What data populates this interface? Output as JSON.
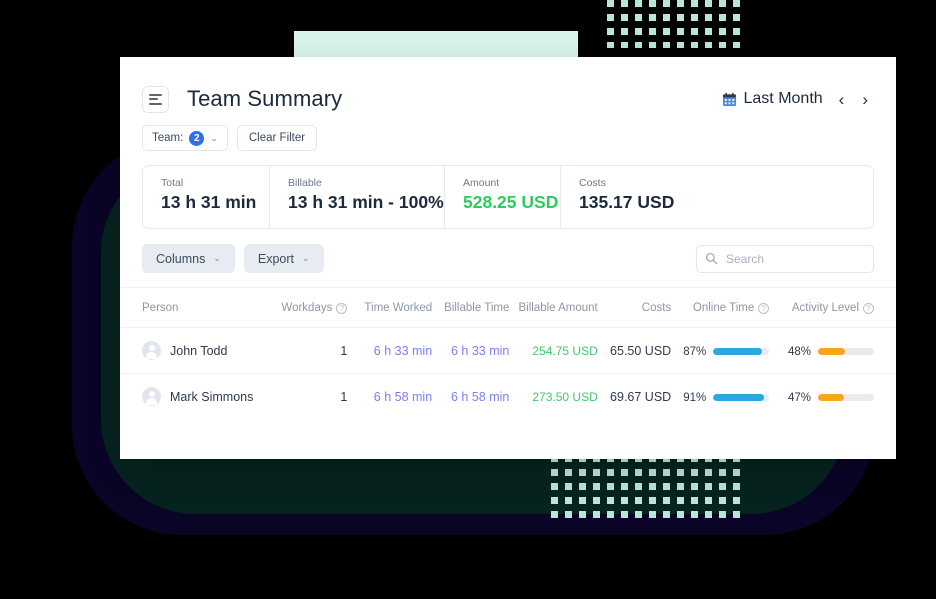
{
  "header": {
    "menu_icon": "hamburger-menu-icon",
    "title": "Team Summary",
    "calendar_icon": "calendar-icon",
    "date_range_label": "Last Month",
    "prev_arrow": "‹",
    "next_arrow": "›"
  },
  "filters": {
    "team_label": "Team:",
    "team_count": "2",
    "chevron": "⌄",
    "clear_filter_label": "Clear Filter"
  },
  "stats": [
    {
      "label": "Total",
      "value": "13 h 31 min",
      "color": "#1b2a3d"
    },
    {
      "label": "Billable",
      "value": "13 h 31 min - 100%",
      "color": "#1b2a3d"
    },
    {
      "label": "Amount",
      "value": "528.25 USD",
      "color": "#2ecc5e"
    },
    {
      "label": "Costs",
      "value": "135.17 USD",
      "color": "#1b2a3d"
    }
  ],
  "toolbar": {
    "columns_label": "Columns",
    "export_label": "Export",
    "chevron": "⌄",
    "search_icon": "search-icon",
    "search_placeholder": "Search",
    "search_value": ""
  },
  "table": {
    "columns": [
      {
        "key": "person",
        "label": "Person",
        "help": false
      },
      {
        "key": "workdays",
        "label": "Workdays",
        "help": true
      },
      {
        "key": "worked",
        "label": "Time Worked",
        "help": false
      },
      {
        "key": "billtime",
        "label": "Billable Time",
        "help": false
      },
      {
        "key": "billamt",
        "label": "Billable Amount",
        "help": false
      },
      {
        "key": "costs",
        "label": "Costs",
        "help": false
      },
      {
        "key": "online",
        "label": "Online Time",
        "help": true
      },
      {
        "key": "activity",
        "label": "Activity Level",
        "help": true
      }
    ],
    "help_glyph": "?",
    "rows": [
      {
        "person": "John Todd",
        "avatar_icon": "user-avatar-icon",
        "workdays": "1",
        "worked": "6 h 33 min",
        "billtime": "6 h 33 min",
        "billamt": "254.75 USD",
        "costs": "65.50 USD",
        "online_pct_label": "87%",
        "online_pct": 87,
        "activity_pct_label": "48%",
        "activity_pct": 48
      },
      {
        "person": "Mark Simmons",
        "avatar_icon": "user-avatar-icon",
        "workdays": "1",
        "worked": "6 h 58 min",
        "billtime": "6 h 58 min",
        "billamt": "273.50 USD",
        "costs": "69.67 USD",
        "online_pct_label": "91%",
        "online_pct": 91,
        "activity_pct_label": "47%",
        "activity_pct": 47
      }
    ]
  },
  "colors": {
    "accent_blue": "#2f6fed",
    "green": "#2ecc5e",
    "money_green": "#3fc96b",
    "link_purple": "#7b7ff0",
    "bar_blue": "#29a9e0",
    "bar_orange": "#f7a51b",
    "mint": "#d9f5ea",
    "dot_mint": "#b9e6d8",
    "blob_navy": "#0a0526",
    "blob_green": "#07231f"
  }
}
